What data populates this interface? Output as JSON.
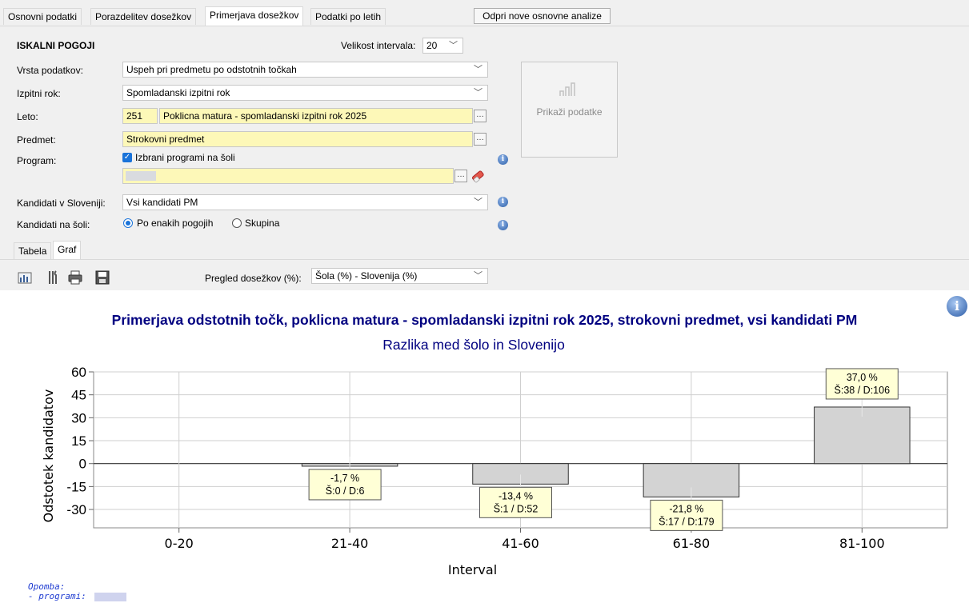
{
  "top_tabs": [
    "Osnovni podatki",
    "Porazdelitev dosežkov",
    "Primerjava dosežkov",
    "Podatki po letih"
  ],
  "open_new_button": "Odpri nove osnovne analize",
  "form": {
    "header": "ISKALNI POGOJI",
    "interval_label": "Velikost intervala:",
    "interval_value": "20",
    "data_type_label": "Vrsta podatkov:",
    "data_type_value": "Uspeh pri predmetu po odstotnih točkah",
    "exam_term_label": "Izpitni rok:",
    "exam_term_value": "Spomladanski izpitni rok",
    "year_label": "Leto:",
    "year_code": "251",
    "year_value": "Poklicna matura - spomladanski izpitni rok 2025",
    "subject_label": "Predmet:",
    "subject_value": "Strokovni predmet",
    "program_label": "Program:",
    "program_checkbox_label": "Izbrani programi na šoli",
    "candidates_slo_label": "Kandidati v Sloveniji:",
    "candidates_slo_value": "Vsi kandidati PM",
    "candidates_school_label": "Kandidati na šoli:",
    "radio_same": "Po enakih pogojih",
    "radio_group": "Skupina",
    "show_button": "Prikaži podatke"
  },
  "sub_tabs": [
    "Tabela",
    "Graf"
  ],
  "toolbar": {
    "overview_label": "Pregled dosežkov (%):",
    "overview_value": "Šola (%) - Slovenija (%)"
  },
  "notes": {
    "line1": "Opomba:",
    "line2": " - programi:"
  },
  "chart_data": {
    "type": "bar",
    "title": "Primerjava odstotnih točk, poklicna matura - spomladanski izpitni rok 2025, strokovni predmet, vsi kandidati PM",
    "subtitle": "Razlika med šolo in Slovenijo",
    "xlabel": "Interval",
    "ylabel": "Odstotek kandidatov",
    "categories": [
      "0-20",
      "21-40",
      "41-60",
      "61-80",
      "81-100"
    ],
    "values": [
      null,
      -1.7,
      -13.4,
      -21.8,
      37.0
    ],
    "value_labels": [
      "",
      "-1,7 %",
      "-13,4 %",
      "-21,8 %",
      "37,0 %"
    ],
    "count_labels": [
      "",
      "Š:0 / D:6",
      "Š:1 / D:52",
      "Š:17 / D:179",
      "Š:38 / D:106"
    ],
    "yticks": [
      "60",
      "45",
      "30",
      "15",
      "0",
      "-15",
      "-30"
    ],
    "ylim": [
      -42,
      60
    ],
    "grid": true,
    "bar_color": "#d3d3d3"
  }
}
